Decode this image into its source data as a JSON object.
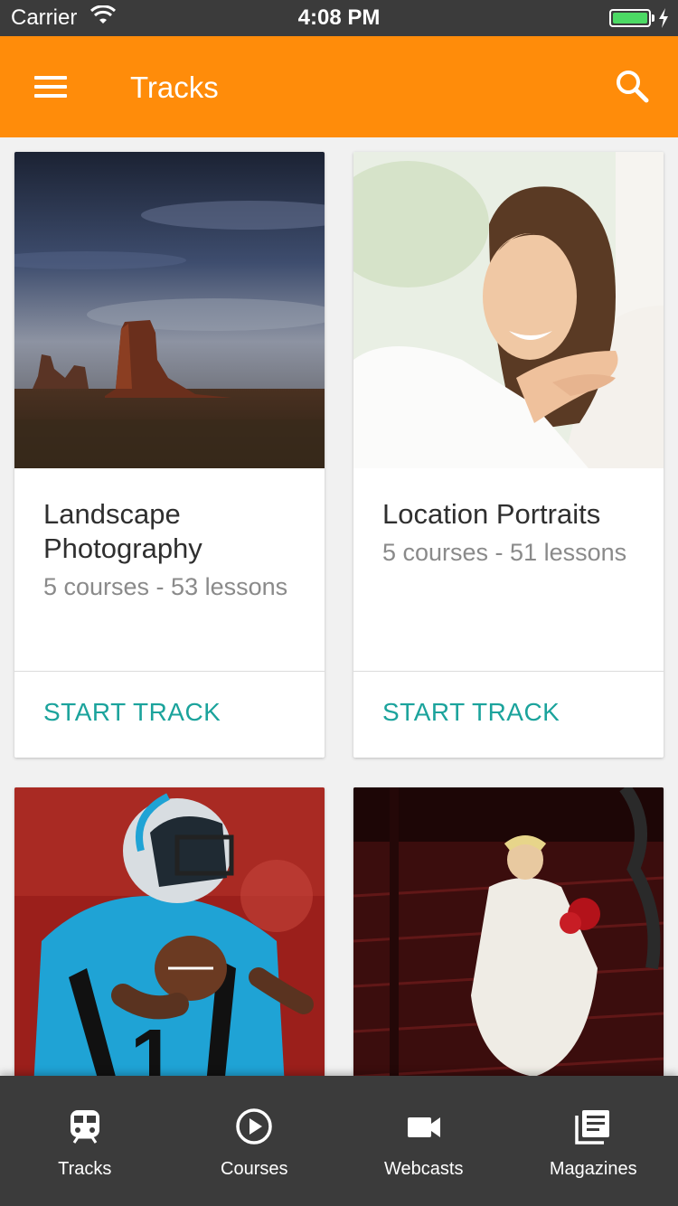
{
  "status_bar": {
    "carrier": "Carrier",
    "time": "4:08 PM",
    "battery_level": 1.0,
    "battery_color": "#4cd964"
  },
  "app_bar": {
    "title": "Tracks",
    "background": "#ff8c0a",
    "menu_icon": "hamburger-menu-icon",
    "search_icon": "search-icon"
  },
  "tracks": [
    {
      "title": "Landscape Photography",
      "meta": "5 courses - 53 lessons",
      "action": "START TRACK",
      "image": "desert-butte-landscape"
    },
    {
      "title": "Location Portraits",
      "meta": "5 courses - 51 lessons",
      "action": "START TRACK",
      "image": "smiling-woman-portrait"
    },
    {
      "image": "football-player"
    },
    {
      "image": "bride-on-staircase"
    }
  ],
  "tab_bar": {
    "tabs": [
      {
        "label": "Tracks",
        "icon": "train-icon"
      },
      {
        "label": "Courses",
        "icon": "play-circle-icon"
      },
      {
        "label": "Webcasts",
        "icon": "video-camera-icon"
      },
      {
        "label": "Magazines",
        "icon": "library-books-icon"
      }
    ]
  },
  "colors": {
    "accent": "#1ba39c",
    "tab_bar": "#3b3b3b"
  }
}
